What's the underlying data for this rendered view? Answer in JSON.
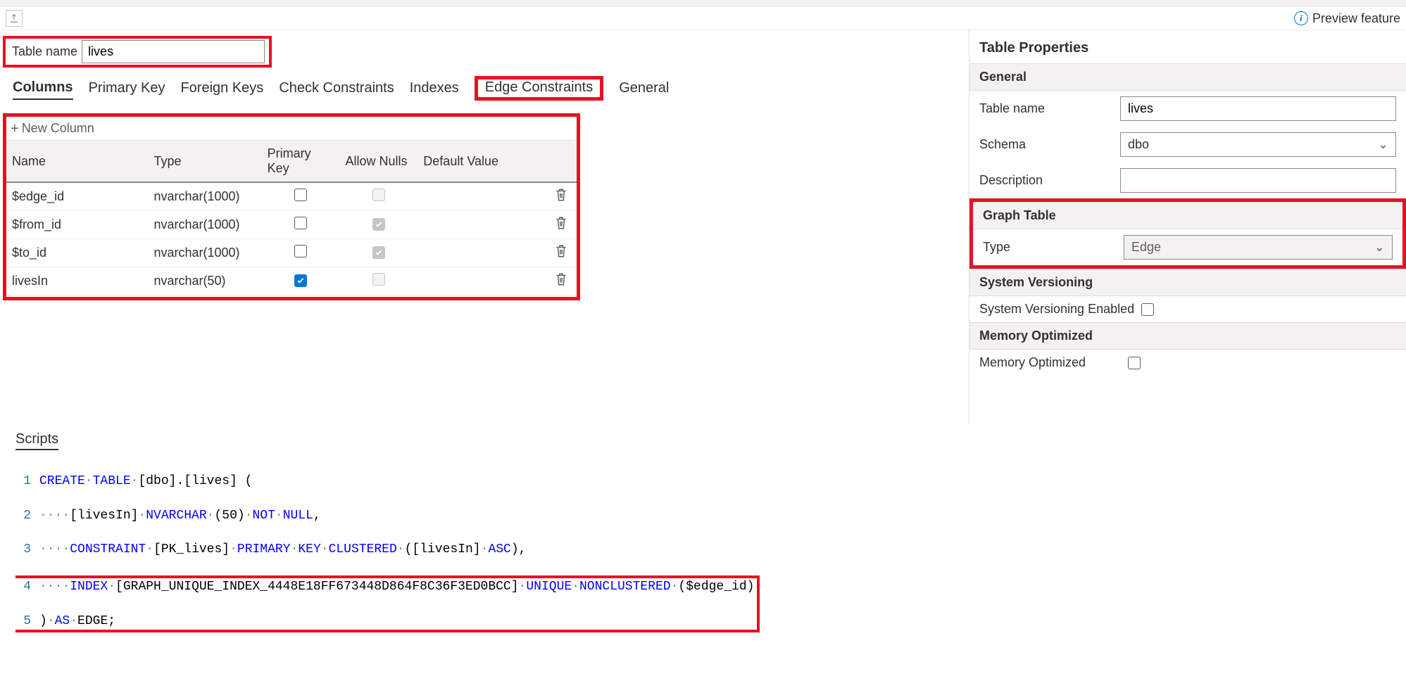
{
  "header": {
    "preview_label": "Preview feature"
  },
  "table_name_label": "Table name",
  "table_name_value": "lives",
  "tabs": {
    "columns": "Columns",
    "primary_key": "Primary Key",
    "foreign_keys": "Foreign Keys",
    "check_constraints": "Check Constraints",
    "indexes": "Indexes",
    "edge_constraints": "Edge Constraints",
    "general": "General"
  },
  "new_column_label": "New Column",
  "col_headers": {
    "name": "Name",
    "type": "Type",
    "pk": "Primary Key",
    "nulls": "Allow Nulls",
    "def": "Default Value"
  },
  "columns": [
    {
      "name": "$edge_id",
      "type": "nvarchar(1000)",
      "pk": false,
      "pk_enabled": true,
      "nulls": false,
      "nulls_enabled": false,
      "def": ""
    },
    {
      "name": "$from_id",
      "type": "nvarchar(1000)",
      "pk": false,
      "pk_enabled": true,
      "nulls": true,
      "nulls_enabled": false,
      "def": ""
    },
    {
      "name": "$to_id",
      "type": "nvarchar(1000)",
      "pk": false,
      "pk_enabled": true,
      "nulls": true,
      "nulls_enabled": false,
      "def": ""
    },
    {
      "name": "livesIn",
      "type": "nvarchar(50)",
      "pk": true,
      "pk_enabled": true,
      "nulls": false,
      "nulls_enabled": false,
      "def": ""
    }
  ],
  "props": {
    "title": "Table Properties",
    "sections": {
      "general": "General",
      "graph": "Graph Table",
      "sysver": "System Versioning",
      "memopt": "Memory Optimized"
    },
    "labels": {
      "table_name": "Table name",
      "schema": "Schema",
      "description": "Description",
      "type": "Type",
      "sysver_enabled": "System Versioning Enabled",
      "memopt": "Memory Optimized"
    },
    "values": {
      "table_name": "lives",
      "schema": "dbo",
      "description": "",
      "type": "Edge",
      "sysver_enabled": false,
      "memopt": false
    }
  },
  "scripts": {
    "title": "Scripts",
    "lines": {
      "l1_a": "CREATE",
      "l1_b": "TABLE",
      "l1_c": "[dbo].[lives] (",
      "l2_a": "[livesIn]",
      "l2_b": "NVARCHAR",
      "l2_c": "(50)",
      "l2_d": "NOT",
      "l2_e": "NULL",
      "l2_f": ",",
      "l3_a": "CONSTRAINT",
      "l3_b": "[PK_lives]",
      "l3_c": "PRIMARY",
      "l3_d": "KEY",
      "l3_e": "CLUSTERED",
      "l3_f": "([livesIn]",
      "l3_g": "ASC",
      "l3_h": "),",
      "l4_a": "INDEX",
      "l4_b": "[GRAPH_UNIQUE_INDEX_4448E18FF673448D864F8C36F3ED0BCC]",
      "l4_c": "UNIQUE",
      "l4_d": "NONCLUSTERED",
      "l4_e": "($edge_id)",
      "l5_a": ")",
      "l5_b": "AS",
      "l5_c": "EDGE;"
    }
  }
}
